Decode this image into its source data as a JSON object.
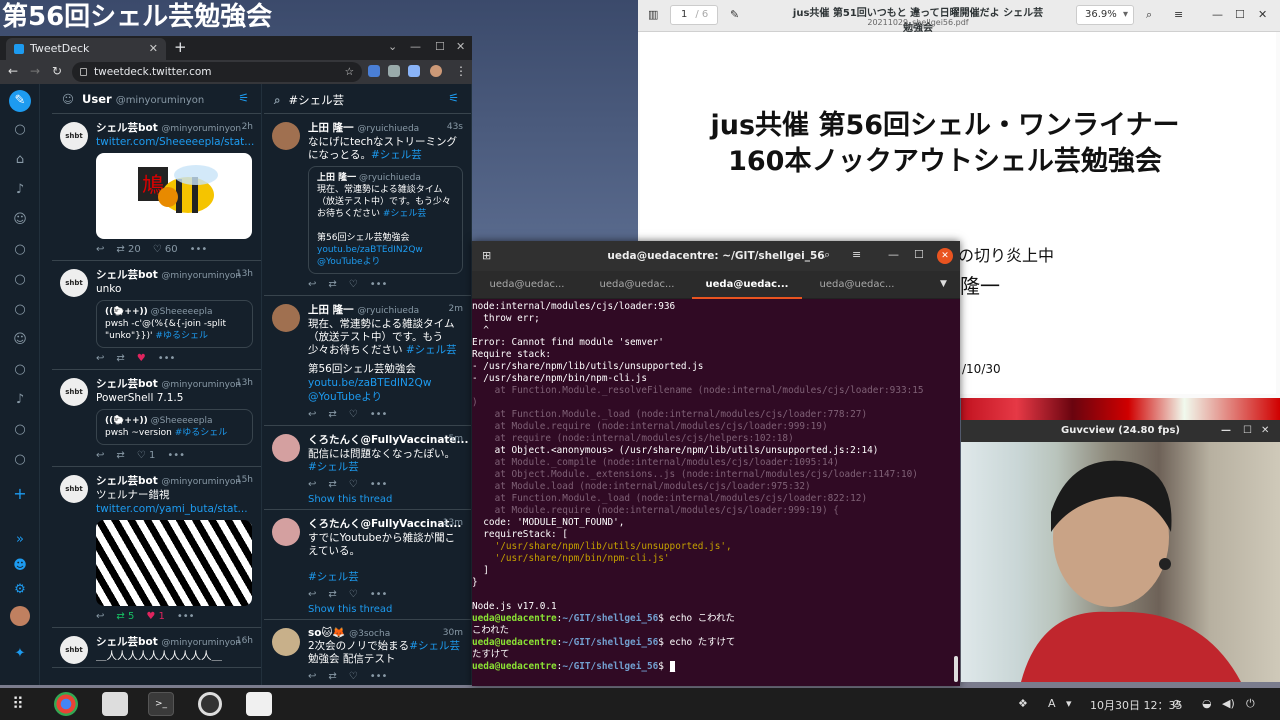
{
  "desktop": {
    "title": "第56回シェル芸勉強会"
  },
  "browser": {
    "tab_title": "TweetDeck",
    "url": "tweetdeck.twitter.com"
  },
  "tweetdeck": {
    "columns": [
      {
        "title": "User",
        "subtitle": "@minyoruminyon",
        "tweets": [
          {
            "name": "シェル芸bot",
            "handle": "@minyoruminyon",
            "time": "2h",
            "text": "",
            "link": "twitter.com/Sheeeeepla/stat...",
            "counts": "20",
            "likes": "60"
          },
          {
            "name": "シェル芸bot",
            "handle": "@minyoruminyon",
            "time": "13h",
            "text": "unko",
            "quote_author": "((🐑++))",
            "quote_handle": "@Sheeeeepla",
            "quote_text": "pwsh -c'@(%{&{-join -split \"unko\"}})'",
            "quote_tag": "#ゆるシェル"
          },
          {
            "name": "シェル芸bot",
            "handle": "@minyoruminyon",
            "time": "13h",
            "text": "PowerShell 7.1.5",
            "quote_author": "((🐑++))",
            "quote_handle": "@Sheeeeepla",
            "quote_text": "pwsh ~version",
            "quote_tag": "#ゆるシェル",
            "likes": "1"
          },
          {
            "name": "シェル芸bot",
            "handle": "@minyoruminyon",
            "time": "15h",
            "text": "ツェルナー錯視",
            "link": "twitter.com/yami_buta/stat...",
            "counts": "5",
            "likes": "1"
          },
          {
            "name": "シェル芸bot",
            "handle": "@minyoruminyon",
            "time": "16h",
            "text": "＿人人人人人人人人人人＿"
          }
        ]
      },
      {
        "title": "#シェル芸",
        "subtitle": "",
        "tweets": [
          {
            "name": "上田 隆一",
            "handle": "@ryuichiueda",
            "time": "43s",
            "text": "なにげにtechなストリーミングになっとる。",
            "tag": "#シェル芸",
            "quote_author": "上田 隆一",
            "quote_handle": "@ryuichiueda",
            "quote_text": "現在、常連勢による雑談タイム（放送テスト中）です。もう少々お待ちください",
            "quote_tag": "#シェル芸",
            "quote_text2": "第56回シェル芸勉強会",
            "quote_link": "youtu.be/zaBTEdIN2Qw",
            "quote_link2": "@YouTubeより"
          },
          {
            "name": "上田 隆一",
            "handle": "@ryuichiueda",
            "time": "2m",
            "text": "現在、常連勢による雑談タイム（放送テスト中）です。もう少々お待ちください",
            "tag": "#シェル芸",
            "text2": "第56回シェル芸勉強会",
            "link": "youtu.be/zaBTEdIN2Qw",
            "link2": "@YouTubeより"
          },
          {
            "name": "くろたんく@FullyVaccinate...",
            "handle": "",
            "time": "5m",
            "text": "配信には問題なくなったぽい。",
            "tag": "#シェル芸",
            "thread": "Show this thread"
          },
          {
            "name": "くろたんく@FullyVaccinat...",
            "handle": "",
            "time": "13m",
            "text": "すでにYoutubeから雑談が聞こえている。",
            "tag": "#シェル芸",
            "thread": "Show this thread"
          },
          {
            "name": "so🐱🦊",
            "handle": "@3socha",
            "time": "30m",
            "text": "2次会のノリで始まる",
            "tag": "#シェル芸",
            "text2": "勉強会 配信テスト"
          }
        ]
      }
    ]
  },
  "pdf": {
    "title": "jus共催 第51回いつもと 違って日曜開催だよ シェル芸勉強会",
    "filename": "20211029_shellgei56.pdf",
    "page": "1",
    "page_total": "/ 6",
    "zoom": "36.9%",
    "slide_title_line1": "jus共催 第56回シェル・ワンライナー",
    "slide_title_line2": "160本ノックアウトシェル芸勉強会",
    "slide_line3": "の切り炎上中",
    "slide_line4": "隆一",
    "slide_date": "/10/30"
  },
  "terminal": {
    "title": "ueda@uedacentre: ~/GIT/shellgei_56",
    "tabs": [
      "ueda@uedac...",
      "ueda@uedac...",
      "ueda@uedac...",
      "ueda@uedac..."
    ],
    "active_tab": 2,
    "lines": [
      "node:internal/modules/cjs/loader:936",
      "  throw err;",
      "  ^",
      "",
      "Error: Cannot find module 'semver'",
      "Require stack:",
      "- /usr/share/npm/lib/utils/unsupported.js",
      "- /usr/share/npm/bin/npm-cli.js"
    ],
    "dim_lines": [
      "    at Function.Module._resolveFilename (node:internal/modules/cjs/loader:933:15",
      ")",
      "    at Function.Module._load (node:internal/modules/cjs/loader:778:27)",
      "    at Module.require (node:internal/modules/cjs/loader:999:19)",
      "    at require (node:internal/modules/cjs/helpers:102:18)"
    ],
    "bright_line": "    at Object.<anonymous> (/usr/share/npm/lib/utils/unsupported.js:2:14)",
    "dim_lines2": [
      "    at Module._compile (node:internal/modules/cjs/loader:1095:14)",
      "    at Object.Module._extensions..js (node:internal/modules/cjs/loader:1147:10)",
      "    at Module.load (node:internal/modules/cjs/loader:975:32)",
      "    at Function.Module._load (node:internal/modules/cjs/loader:822:12)",
      "    at Module.require (node:internal/modules/cjs/loader:999:19) {"
    ],
    "code_line": "  code: 'MODULE_NOT_FOUND',",
    "stack_line": "  requireStack: [",
    "stack_items": [
      "    '/usr/share/npm/lib/utils/unsupported.js',",
      "    '/usr/share/npm/bin/npm-cli.js'"
    ],
    "close1": "  ]",
    "close2": "}",
    "node_version": "Node.js v17.0.1",
    "prompt_user": "ueda@uedacentre",
    "prompt_path": "~/GIT/shellgei_56",
    "cmd1": "echo こわれた",
    "out1": "こわれた",
    "cmd2": "echo たすけて",
    "out2": "たすけて"
  },
  "guvcview": {
    "title": "Guvcview  (24.80 fps)"
  },
  "taskbar": {
    "clock": "10月30日  12：35",
    "ime": "A"
  },
  "colors": {
    "twitter_blue": "#1d9bf0",
    "terminal_bg": "#300a24",
    "ubuntu_orange": "#e95420"
  }
}
